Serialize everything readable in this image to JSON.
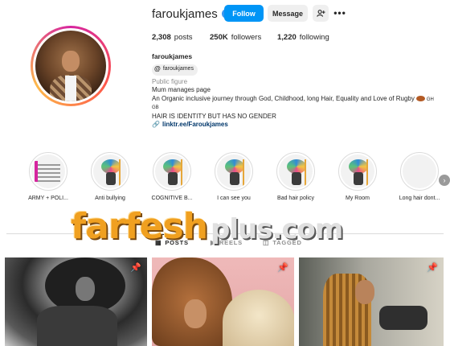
{
  "profile": {
    "username": "faroukjames",
    "verified_mark": "✓",
    "follow_label": "Follow",
    "message_label": "Message",
    "add_user_icon": "add-user-icon",
    "more_icon": "•••"
  },
  "stats": {
    "posts_count": "2,308",
    "posts_label": "posts",
    "followers_count": "250K",
    "followers_label": "followers",
    "following_count": "1,220",
    "following_label": "following"
  },
  "bio": {
    "name": "faroukjames",
    "threads_handle": "faroukjames",
    "threads_icon": "@",
    "category": "Public figure",
    "line1": "Mum manages page",
    "line2": "An Organic inclusive journey through God, Childhood, long Hair, Equality and Love of Rugby",
    "flag_after": "GH",
    "flag_line": "GB",
    "line3": "HAIR IS IDENTITY BUT HAS NO GENDER",
    "link": "linktr.ee/Faroukjames"
  },
  "highlights": [
    {
      "label": "ARMY + POLI...",
      "thumb": "doc"
    },
    {
      "label": "Anti bullying",
      "thumb": "cartoon"
    },
    {
      "label": "COGNITIVE B...",
      "thumb": "cartoon"
    },
    {
      "label": "I can see you",
      "thumb": "cartoon"
    },
    {
      "label": "Bad hair policy",
      "thumb": "cartoon"
    },
    {
      "label": "My Room",
      "thumb": "cartoon"
    },
    {
      "label": "Long hair dont...",
      "thumb": "people"
    }
  ],
  "watermark": {
    "brand": "farfesh",
    "suffix": "plus.com"
  },
  "tabs": [
    {
      "label": "POSTS",
      "icon": "grid-icon",
      "active": true
    },
    {
      "label": "REELS",
      "icon": "reels-icon",
      "active": false
    },
    {
      "label": "TAGGED",
      "icon": "tag-icon",
      "active": false
    }
  ],
  "colors": {
    "follow_button": "#0095f6",
    "link": "#00376b",
    "verified": "#3897f0",
    "watermark_orange": "#f0a020"
  }
}
